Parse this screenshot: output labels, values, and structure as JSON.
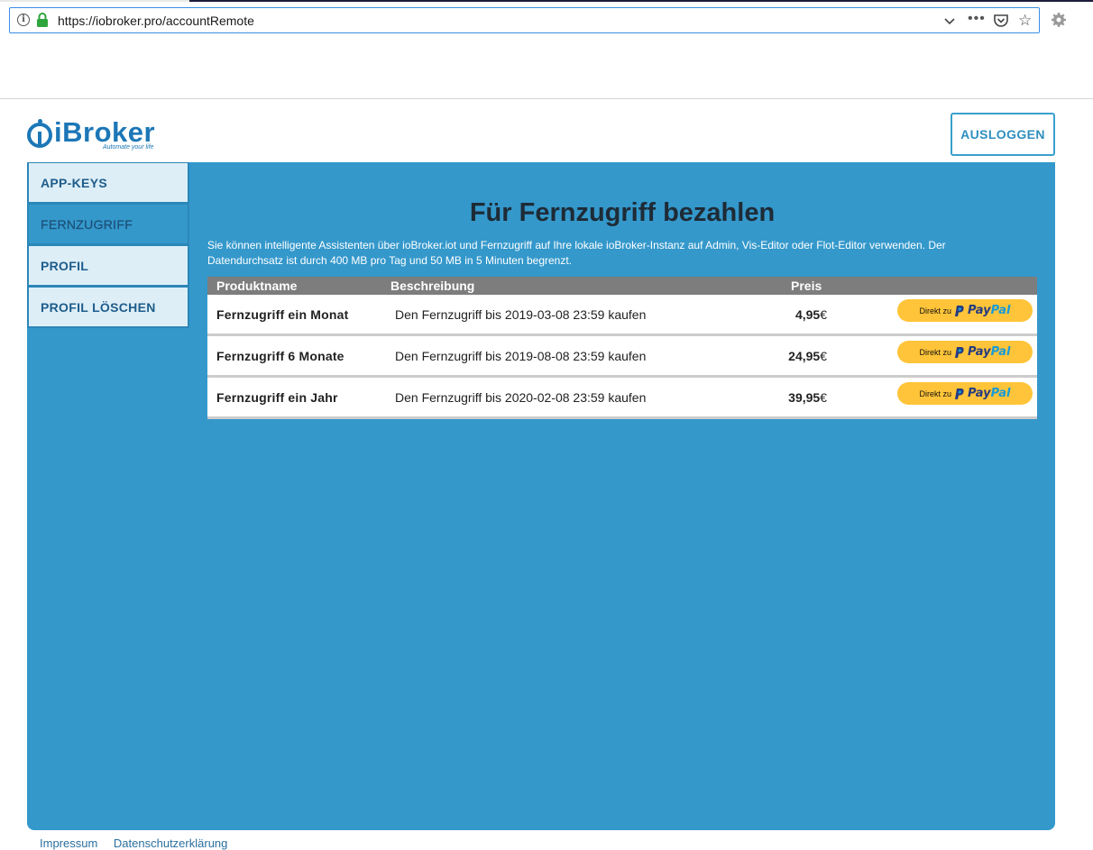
{
  "browser": {
    "url": "https://iobroker.pro/accountRemote"
  },
  "header": {
    "logo_text": "iBroker",
    "logo_tagline": "Automate your life",
    "logout_label": "AUSLOGGEN"
  },
  "sidebar": {
    "items": [
      {
        "label": "APP-KEYS",
        "active": false
      },
      {
        "label": "FERNZUGRIFF",
        "active": true
      },
      {
        "label": "PROFIL",
        "active": false
      },
      {
        "label": "PROFIL LÖSCHEN",
        "active": false
      }
    ]
  },
  "main": {
    "title": "Für Fernzugriff bezahlen",
    "description": "Sie können intelligente Assistenten über ioBroker.iot und Fernzugriff auf Ihre lokale ioBroker-Instanz auf Admin, Vis-Editor oder Flot-Editor verwenden. Der Datendurchsatz ist durch 400 MB pro Tag und 50 MB in 5 Minuten begrenzt.",
    "table": {
      "headers": [
        "Produktname",
        "Beschreibung",
        "Preis"
      ],
      "rows": [
        {
          "name": "Fernzugriff ein Monat",
          "description": "Den Fernzugriff bis 2019-03-08 23:59 kaufen",
          "price": "4,95",
          "currency": "€"
        },
        {
          "name": "Fernzugriff 6 Monate",
          "description": "Den Fernzugriff bis 2019-08-08 23:59 kaufen",
          "price": "24,95",
          "currency": "€"
        },
        {
          "name": "Fernzugriff ein Jahr",
          "description": "Den Fernzugriff bis 2020-02-08 23:59 kaufen",
          "price": "39,95",
          "currency": "€"
        }
      ],
      "paypal": {
        "prefix": "Direkt zu",
        "pay": "Pay",
        "pal": "Pal"
      }
    }
  },
  "footer": {
    "links": [
      "Impressum",
      "Datenschutzerklärung"
    ]
  },
  "colors": {
    "panel": "#3498cb",
    "sidebar_bg": "#ddeef7",
    "table_header": "#7d7d7d",
    "paypal_button": "#ffc439",
    "logo": "#1c77b7"
  }
}
